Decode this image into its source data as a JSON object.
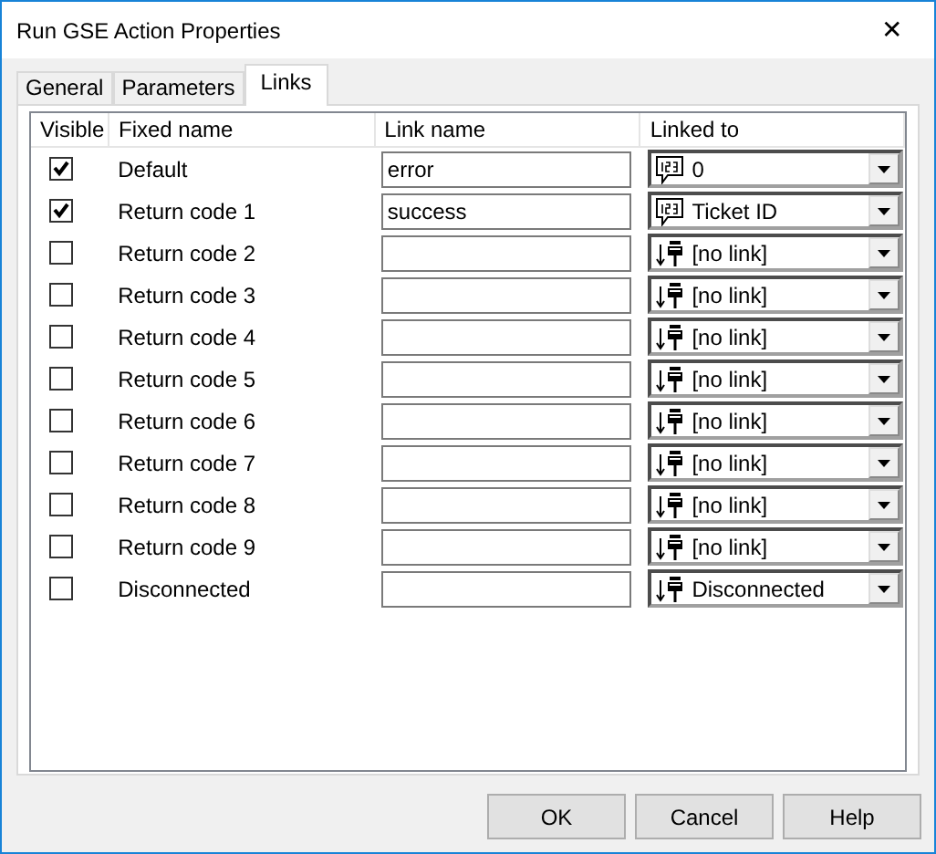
{
  "window": {
    "title": "Run GSE Action Properties",
    "close": "✕"
  },
  "tabs": [
    {
      "label": "General",
      "selected": false
    },
    {
      "label": "Parameters",
      "selected": false
    },
    {
      "label": "Links",
      "selected": true
    }
  ],
  "table": {
    "columns": [
      "Visible",
      "Fixed name",
      "Link name",
      "Linked to"
    ],
    "rows": [
      {
        "visible": true,
        "fixed_name": "Default",
        "link_name": "error",
        "linked_to": {
          "kind": "value",
          "text": "0"
        }
      },
      {
        "visible": true,
        "fixed_name": "Return code 1",
        "link_name": "success",
        "linked_to": {
          "kind": "value",
          "text": "Ticket ID"
        }
      },
      {
        "visible": false,
        "fixed_name": "Return code 2",
        "link_name": "",
        "linked_to": {
          "kind": "connector",
          "text": "[no link]"
        }
      },
      {
        "visible": false,
        "fixed_name": "Return code 3",
        "link_name": "",
        "linked_to": {
          "kind": "connector",
          "text": "[no link]"
        }
      },
      {
        "visible": false,
        "fixed_name": "Return code 4",
        "link_name": "",
        "linked_to": {
          "kind": "connector",
          "text": "[no link]"
        }
      },
      {
        "visible": false,
        "fixed_name": "Return code 5",
        "link_name": "",
        "linked_to": {
          "kind": "connector",
          "text": "[no link]"
        }
      },
      {
        "visible": false,
        "fixed_name": "Return code 6",
        "link_name": "",
        "linked_to": {
          "kind": "connector",
          "text": "[no link]"
        }
      },
      {
        "visible": false,
        "fixed_name": "Return code 7",
        "link_name": "",
        "linked_to": {
          "kind": "connector",
          "text": "[no link]"
        }
      },
      {
        "visible": false,
        "fixed_name": "Return code 8",
        "link_name": "",
        "linked_to": {
          "kind": "connector",
          "text": "[no link]"
        }
      },
      {
        "visible": false,
        "fixed_name": "Return code 9",
        "link_name": "",
        "linked_to": {
          "kind": "connector",
          "text": "[no link]"
        }
      },
      {
        "visible": false,
        "fixed_name": "Disconnected",
        "link_name": "",
        "linked_to": {
          "kind": "connector",
          "text": "Disconnected"
        }
      }
    ]
  },
  "buttons": [
    "OK",
    "Cancel",
    "Help"
  ]
}
